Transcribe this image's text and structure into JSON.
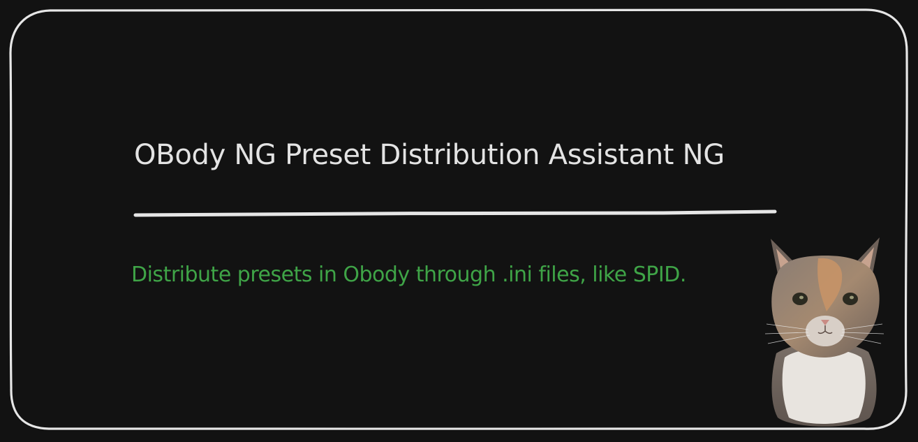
{
  "card": {
    "title": "OBody NG Preset Distribution Assistant NG",
    "tagline": "Distribute presets in Obody through .ini files, like SPID."
  },
  "colors": {
    "background": "#121212",
    "frame": "#e6e6e6",
    "title": "#e3e3e3",
    "tagline": "#3fa447"
  },
  "icons": {
    "mascot": "cat-photo"
  }
}
